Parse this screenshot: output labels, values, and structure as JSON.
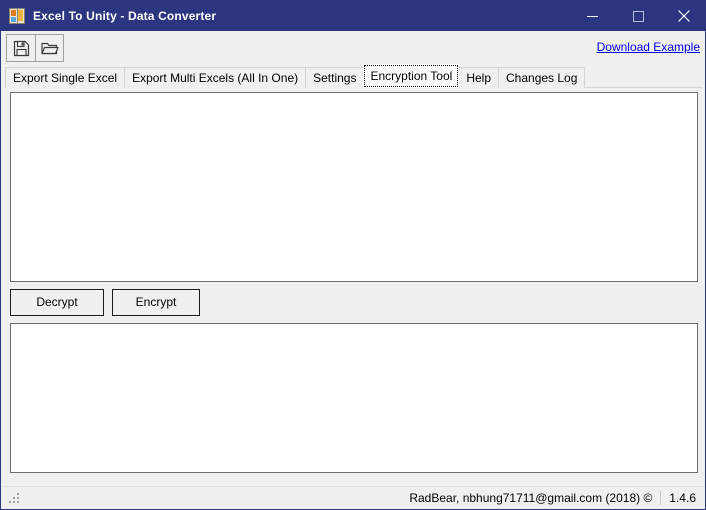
{
  "window": {
    "title": "Excel To Unity - Data Converter",
    "icon": "app-form-icon",
    "accent_color": "#2b3580",
    "controls": {
      "minimize": "minimize-icon",
      "maximize": "maximize-icon",
      "close": "close-icon"
    }
  },
  "toolbar": {
    "buttons": [
      {
        "name": "save-button",
        "icon": "floppy-disk-icon",
        "tooltip": "Save"
      },
      {
        "name": "open-button",
        "icon": "folder-open-icon",
        "tooltip": "Open"
      }
    ],
    "download_link": "Download Example",
    "link_color": "#0000ee"
  },
  "tabs": [
    {
      "label": "Export Single Excel",
      "selected": false
    },
    {
      "label": "Export Multi Excels (All In One)",
      "selected": false
    },
    {
      "label": "Settings",
      "selected": false
    },
    {
      "label": "Encryption Tool",
      "selected": true
    },
    {
      "label": "Help",
      "selected": false
    },
    {
      "label": "Changes Log",
      "selected": false
    }
  ],
  "encryption_tool": {
    "input_text": "",
    "input_placeholder": "",
    "output_text": "",
    "output_placeholder": "",
    "buttons": {
      "decrypt": "Decrypt",
      "encrypt": "Encrypt"
    }
  },
  "statusbar": {
    "credits": "RadBear, nbhung71711@gmail.com (2018) ©",
    "version": "1.4.6",
    "grip": "resize-grip-icon"
  }
}
